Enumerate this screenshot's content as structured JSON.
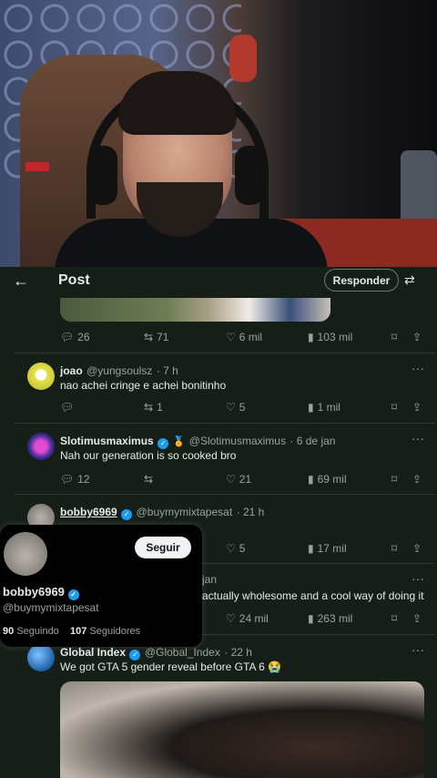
{
  "header": {
    "title": "Post",
    "reply_button": "Responder"
  },
  "top_post_actions": {
    "replies": "26",
    "reposts": "71",
    "likes": "6 mil",
    "views": "103 mil"
  },
  "tweets": [
    {
      "name": "joao",
      "handle": "@yungsoulsz",
      "time": "· 7 h",
      "text": "nao achei cringe e achei bonitinho",
      "replies": "",
      "reposts": "1",
      "likes": "5",
      "views": "1 mil"
    },
    {
      "name": "Slotimusmaximus",
      "handle": "@Slotimusmaximus",
      "time": "· 6 de jan",
      "text": "Nah our generation is so cooked bro",
      "replies": "12",
      "reposts": "",
      "likes": "21",
      "views": "69 mil"
    },
    {
      "name": "bobby6969",
      "handle": "@buymymixtapesat",
      "time": "· 21 h",
      "text": "",
      "replies": "",
      "reposts": "",
      "likes": "5",
      "views": "17 mil"
    },
    {
      "name": "",
      "handle": "",
      "time": "jan",
      "text": "actually wholesome and a cool way of doing it",
      "replies": "",
      "reposts": "",
      "likes": "24 mil",
      "views": "263 mil"
    },
    {
      "name": "Global Index",
      "handle": "@Global_Index",
      "time": "· 22 h",
      "text": "We got GTA 5 gender reveal before GTA 6 😭"
    }
  ],
  "hover_card": {
    "follow_button": "Seguir",
    "name": "bobby6969",
    "handle": "@buymymixtapesat",
    "following_count": "90",
    "following_label": "Seguindo",
    "followers_count": "107",
    "followers_label": "Seguidores"
  },
  "colors": {
    "background": "#151f17",
    "verified": "#1d9bf0",
    "text": "#e7e9ea",
    "muted": "#9aa39c"
  }
}
